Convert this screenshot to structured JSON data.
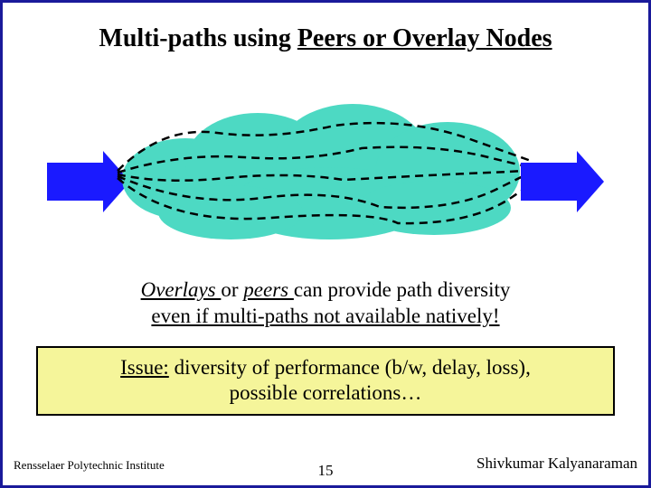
{
  "title": {
    "plain": "Multi-paths using ",
    "underlined": "Peers or Overlay Nodes"
  },
  "caption": {
    "word1": "Overlays ",
    "mid1": "or ",
    "word2": "peers ",
    "rest1": "can provide path diversity",
    "line2": "even if multi-paths not available natively!"
  },
  "issue": {
    "label": "Issue:",
    "text1": " diversity of performance (b/w, delay, loss),",
    "text2": "possible correlations…"
  },
  "footer": {
    "left": "Rensselaer Polytechnic Institute",
    "right": "Shivkumar Kalyanaraman",
    "page": "15"
  }
}
